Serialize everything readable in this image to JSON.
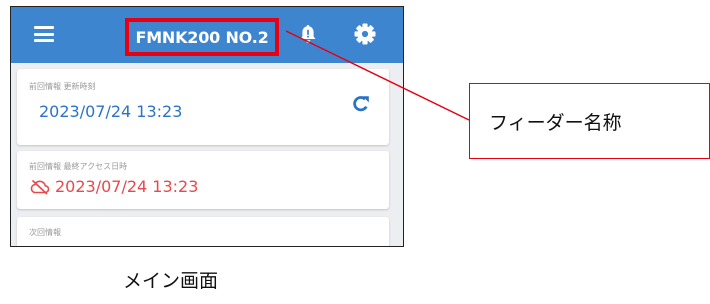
{
  "app": {
    "title": "FMNK200 NO.2",
    "icons": {
      "menu": "menu-icon",
      "notification": "bell-alert-icon",
      "settings": "gear-icon"
    }
  },
  "cards": [
    {
      "label": "前回情報 更新時刻",
      "value": "2023/07/24 13:23",
      "icon": "refresh-icon"
    },
    {
      "label": "前回情報 最終アクセス日時",
      "value": "2023/07/24 13:23",
      "icon": "cloud-off-icon"
    },
    {
      "label": "次回情報"
    }
  ],
  "annotation": {
    "label": "フィーダー名称"
  },
  "caption": "メイン画面",
  "colors": {
    "appbar": "#3d86cf",
    "highlight": "#e60012",
    "value_blue": "#2c73c5",
    "value_red": "#e8484b"
  }
}
